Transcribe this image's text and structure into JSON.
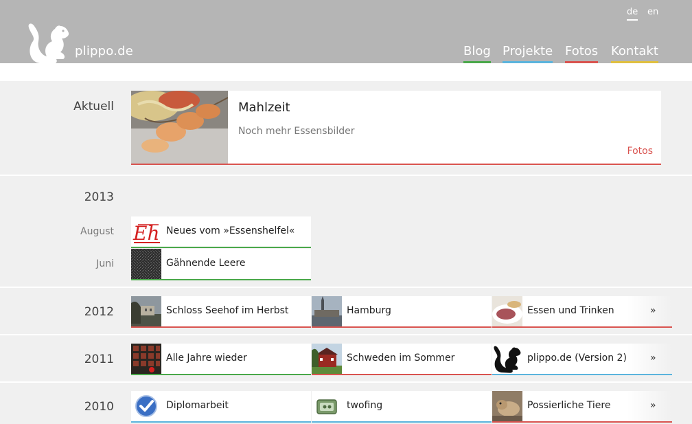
{
  "header": {
    "site_name": "plippo.de",
    "languages": [
      {
        "code": "de",
        "active": true
      },
      {
        "code": "en",
        "active": false
      }
    ],
    "nav": [
      {
        "label": "Blog",
        "color": "#4aa84a"
      },
      {
        "label": "Projekte",
        "color": "#5bb4dd"
      },
      {
        "label": "Fotos",
        "color": "#d9534f"
      },
      {
        "label": "Kontakt",
        "color": "#e0c040"
      }
    ]
  },
  "current": {
    "heading": "Aktuell",
    "title": "Mahlzeit",
    "subtitle": "Noch mehr Essensbilder",
    "category": "Fotos",
    "category_color": "#d9534f"
  },
  "sections": [
    {
      "year": "2013",
      "entries": [
        {
          "month": "August",
          "label": "Neues vom »Essenshelfel«",
          "icon": "eh-logo-icon",
          "color": "#4aa84a"
        },
        {
          "month": "Juni",
          "label": "Gähnende Leere",
          "icon": "noise-thumbnail",
          "color": "#4aa84a"
        }
      ]
    },
    {
      "year": "2012",
      "entries": [
        {
          "label": "Schloss Seehof im Herbst",
          "icon": "castle-photo-thumbnail",
          "color": "#d9534f"
        },
        {
          "label": "Hamburg",
          "icon": "hamburg-photo-thumbnail",
          "color": "#d9534f"
        },
        {
          "label": "Essen und Trinken",
          "icon": "food-photo-thumbnail",
          "color": "#d9534f"
        }
      ],
      "more": "»"
    },
    {
      "year": "2011",
      "entries": [
        {
          "label": "Alle Jahre wieder",
          "icon": "advent-calendar-thumbnail",
          "color": "#4aa84a"
        },
        {
          "label": "Schweden im Sommer",
          "icon": "sweden-house-thumbnail",
          "color": "#d9534f"
        },
        {
          "label": "plippo.de (Version 2)",
          "icon": "squirrel-icon",
          "color": "#5bb4dd"
        }
      ],
      "more": "»"
    },
    {
      "year": "2010",
      "entries": [
        {
          "label": "Diplomarbeit",
          "icon": "checkmark-badge-icon",
          "color": "#5bb4dd"
        },
        {
          "label": "twofing",
          "icon": "touchpad-icon",
          "color": "#5bb4dd"
        },
        {
          "label": "Possierliche Tiere",
          "icon": "animal-photo-thumbnail",
          "color": "#d9534f"
        }
      ],
      "more": "»"
    }
  ]
}
